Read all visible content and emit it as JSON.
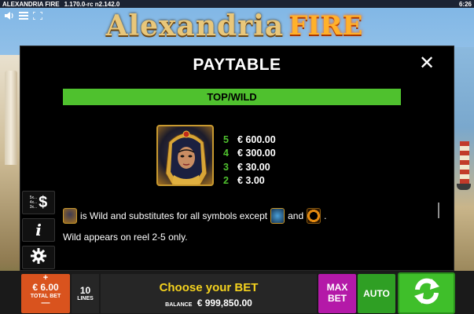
{
  "status_bar": {
    "app_title": "ALEXANDRIA FIRE",
    "version": "1.170.0-rc n2.142.0",
    "clock": "6:26"
  },
  "top_controls": {
    "sound_icon": "speaker-icon",
    "menu_icon": "menu-icon",
    "fullscreen_icon": "fullscreen-icon"
  },
  "logo": {
    "main": "Alexandria",
    "accent": "FIRE"
  },
  "paytable": {
    "title": "PAYTABLE",
    "close": "✕",
    "section_label": "TOP/WILD",
    "payouts": [
      {
        "count": "5",
        "value": "€ 600.00"
      },
      {
        "count": "4",
        "value": "€ 300.00"
      },
      {
        "count": "3",
        "value": "€ 30.00"
      },
      {
        "count": "2",
        "value": "€ 3.00"
      }
    ],
    "wild_text_1": "is Wild and substitutes for all symbols except",
    "wild_text_and": "and",
    "wild_text_end": ".",
    "wild_text_2": "Wild appears on reel 2-5 only."
  },
  "side_buttons": {
    "autoplay_lines": [
      "5x...",
      "4x...",
      "3x..."
    ],
    "autoplay_symbol": "$",
    "info_symbol": "i",
    "settings_icon": "gear-icon"
  },
  "bottom_bar": {
    "bet_plus": "+",
    "bet_value": "€ 6.00",
    "bet_label": "TOTAL BET",
    "bet_minus": "—",
    "lines_value": "10",
    "lines_label": "LINES",
    "message": "Choose your BET",
    "balance_label": "BALANCE",
    "balance_value": "€ 999,850.00",
    "max_bet_line1": "MAX",
    "max_bet_line2": "BET",
    "auto_label": "AUTO",
    "spin_icon": "spin-arrows-icon"
  },
  "colors": {
    "accent_green": "#4fc12e",
    "bet_orange": "#d9531e",
    "max_bet_magenta": "#b419a8",
    "message_yellow": "#f4d21e"
  }
}
